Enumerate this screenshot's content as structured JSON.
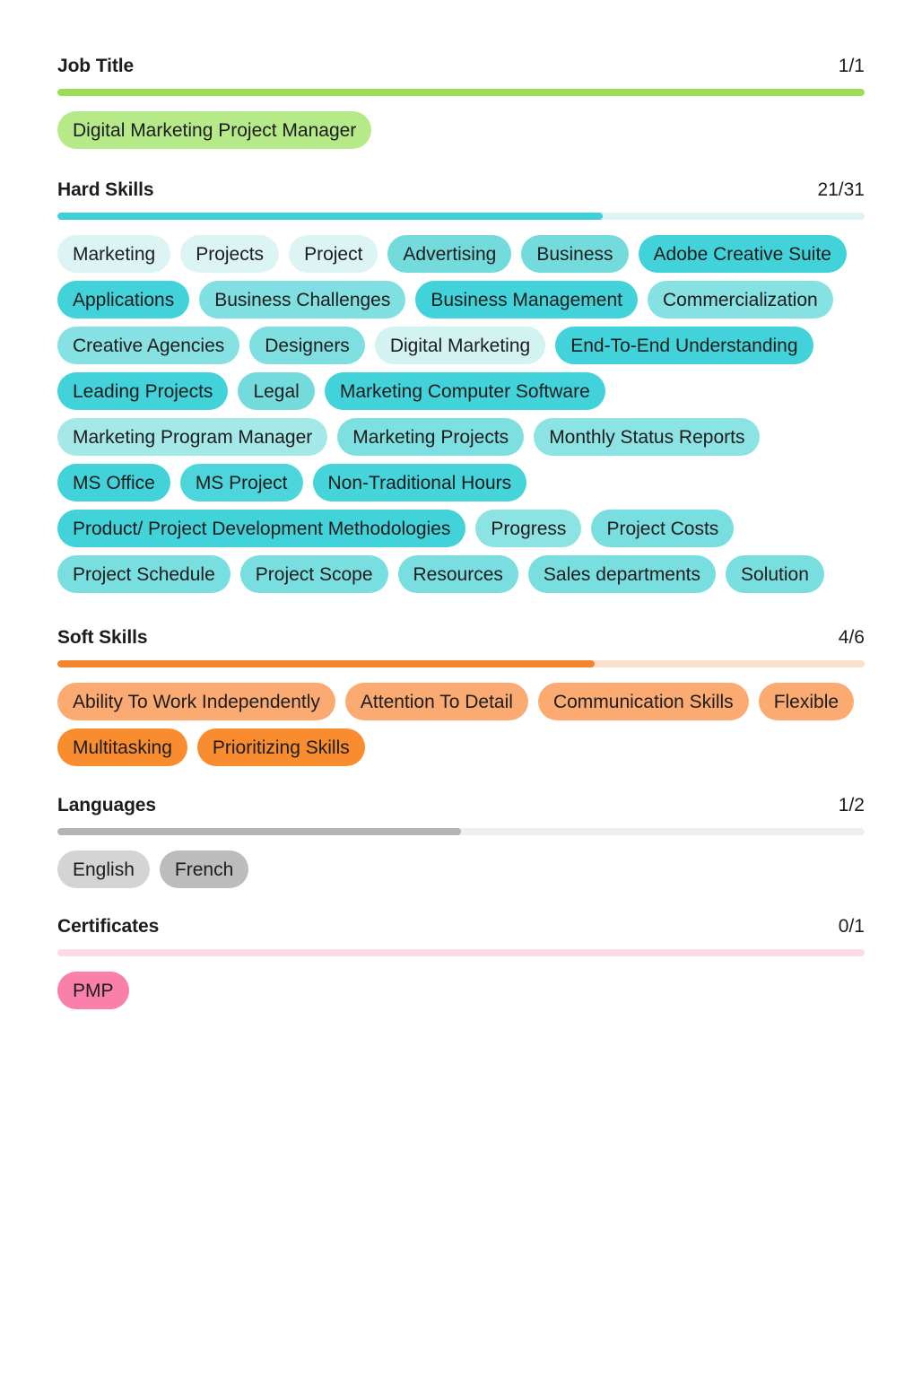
{
  "colors": {
    "job_title_bar_fill": "#9ade54",
    "job_title_bar_track": "#e6f7d4",
    "hard_bar_fill": "#3ed0d8",
    "hard_bar_track": "#ddf4f5",
    "soft_bar_fill": "#f5852c",
    "soft_bar_track": "#fbe0cd",
    "lang_bar_fill": "#b4b4b4",
    "lang_bar_track": "#efefef",
    "cert_bar_fill": "#fbdde5",
    "cert_bar_track": "#fbdde5",
    "text": "#1c1c1c"
  },
  "sections": [
    {
      "id": "job_title",
      "title": "Job Title",
      "count": "1/1",
      "matched": 1,
      "total": 1,
      "fill_percent": 100,
      "bar_fill_color": "#9ade54",
      "bar_track_color": "#e6f7d4",
      "pills": [
        {
          "label": "Digital Marketing Project Manager",
          "color": "#b6e987"
        }
      ]
    },
    {
      "id": "hard_skills",
      "title": "Hard Skills",
      "count": "21/31",
      "matched": 21,
      "total": 31,
      "fill_percent": 67.5,
      "bar_fill_color": "#3ed0d8",
      "bar_track_color": "#ddf4f5",
      "pills": [
        {
          "label": "Marketing",
          "color": "#dcf5f4"
        },
        {
          "label": "Projects",
          "color": "#dcf5f4"
        },
        {
          "label": "Project",
          "color": "#dcf5f4"
        },
        {
          "label": "Advertising",
          "color": "#74dbdd"
        },
        {
          "label": "Business",
          "color": "#74dbdd"
        },
        {
          "label": "Adobe Creative Suite",
          "color": "#42d3da"
        },
        {
          "label": "Applications",
          "color": "#42d3da"
        },
        {
          "label": "Business Challenges",
          "color": "#80dfe0"
        },
        {
          "label": "Business Management",
          "color": "#42d3da"
        },
        {
          "label": "Commercialization",
          "color": "#86e1e2"
        },
        {
          "label": "Creative Agencies",
          "color": "#86e1e2"
        },
        {
          "label": "Designers",
          "color": "#7fdfe0"
        },
        {
          "label": "Digital Marketing",
          "color": "#d3f2f2"
        },
        {
          "label": "End-To-End Understanding",
          "color": "#42d3da"
        },
        {
          "label": "Leading Projects",
          "color": "#42d3da"
        },
        {
          "label": "Legal",
          "color": "#74dbdd"
        },
        {
          "label": "Marketing Computer Software",
          "color": "#42d3da"
        },
        {
          "label": "Marketing Program Manager",
          "color": "#a5e8e8"
        },
        {
          "label": "Marketing Projects",
          "color": "#7edfe0"
        },
        {
          "label": "Monthly Status Reports",
          "color": "#8ce3e3"
        },
        {
          "label": "MS Office",
          "color": "#42d3da"
        },
        {
          "label": "MS Project",
          "color": "#4cd5db"
        },
        {
          "label": "Non-Traditional Hours",
          "color": "#45d4da"
        },
        {
          "label": "Product/ Project Development Methodologies",
          "color": "#42d3da"
        },
        {
          "label": "Progress",
          "color": "#8ce3e3"
        },
        {
          "label": "Project Costs",
          "color": "#79dedf"
        },
        {
          "label": "Project Schedule",
          "color": "#79dedf"
        },
        {
          "label": "Project Scope",
          "color": "#79dedf"
        },
        {
          "label": "Resources",
          "color": "#79dedf"
        },
        {
          "label": "Sales departments",
          "color": "#79dedf"
        },
        {
          "label": "Solution",
          "color": "#79dedf"
        }
      ]
    },
    {
      "id": "soft_skills",
      "title": "Soft Skills",
      "count": "4/6",
      "matched": 4,
      "total": 6,
      "fill_percent": 66.5,
      "bar_fill_color": "#f5852c",
      "bar_track_color": "#fbe0cd",
      "pills": [
        {
          "label": "Ability To Work Independently",
          "color": "#fbab71"
        },
        {
          "label": "Attention To Detail",
          "color": "#fbab71"
        },
        {
          "label": "Communication Skills",
          "color": "#fbab71"
        },
        {
          "label": "Flexible",
          "color": "#fbab71"
        },
        {
          "label": "Multitasking",
          "color": "#f98c2e"
        },
        {
          "label": "Prioritizing Skills",
          "color": "#f98c2e"
        }
      ]
    },
    {
      "id": "languages",
      "title": "Languages",
      "count": "1/2",
      "matched": 1,
      "total": 2,
      "fill_percent": 50,
      "bar_fill_color": "#b4b4b4",
      "bar_track_color": "#efefef",
      "pills": [
        {
          "label": "English",
          "color": "#d4d4d4"
        },
        {
          "label": "French",
          "color": "#bcbcbc"
        }
      ]
    },
    {
      "id": "certificates",
      "title": "Certificates",
      "count": "0/1",
      "matched": 0,
      "total": 1,
      "fill_percent": 0,
      "bar_fill_color": "#fbdde5",
      "bar_track_color": "#fbdde5",
      "pills": [
        {
          "label": "PMP",
          "color": "#fb7fab"
        }
      ]
    }
  ]
}
